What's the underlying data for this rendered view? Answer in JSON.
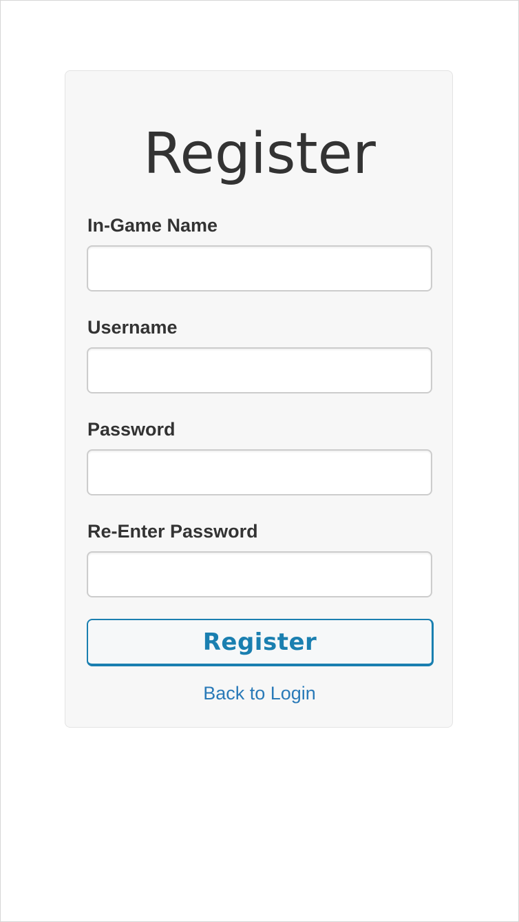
{
  "form": {
    "title": "Register",
    "fields": [
      {
        "label": "In-Game Name",
        "value": "",
        "placeholder": ""
      },
      {
        "label": "Username",
        "value": "",
        "placeholder": ""
      },
      {
        "label": "Password",
        "value": "",
        "placeholder": ""
      },
      {
        "label": "Re-Enter Password",
        "value": "",
        "placeholder": ""
      }
    ],
    "submit_label": "Register",
    "back_link_label": "Back to Login"
  },
  "colors": {
    "accent": "#1a7fb0",
    "link": "#2a7ab8",
    "panel_bg": "#f7f7f7",
    "text": "#333333"
  }
}
